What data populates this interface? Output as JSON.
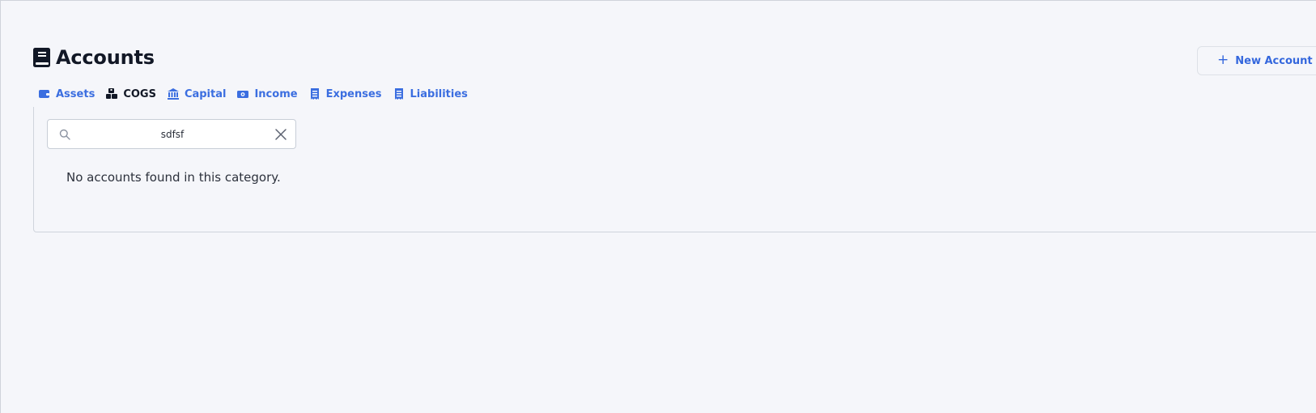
{
  "page": {
    "title": "Accounts",
    "title_icon": "book-icon"
  },
  "actions": {
    "new_account_label": "New Account",
    "new_account_icon": "plus-icon"
  },
  "tabs": [
    {
      "label": "Assets",
      "icon": "wallet-icon",
      "active": false
    },
    {
      "label": "COGS",
      "icon": "boxes-icon",
      "active": true
    },
    {
      "label": "Capital",
      "icon": "bank-icon",
      "active": false
    },
    {
      "label": "Income",
      "icon": "money-icon",
      "active": false
    },
    {
      "label": "Expenses",
      "icon": "receipt-icon",
      "active": false
    },
    {
      "label": "Liabilities",
      "icon": "receipt-icon",
      "active": false
    }
  ],
  "search": {
    "value": "sdfsf",
    "placeholder": ""
  },
  "empty_message": "No accounts found in this category.",
  "colors": {
    "accent": "#3b6ee0",
    "title": "#121826",
    "background": "#f5f6fa"
  }
}
